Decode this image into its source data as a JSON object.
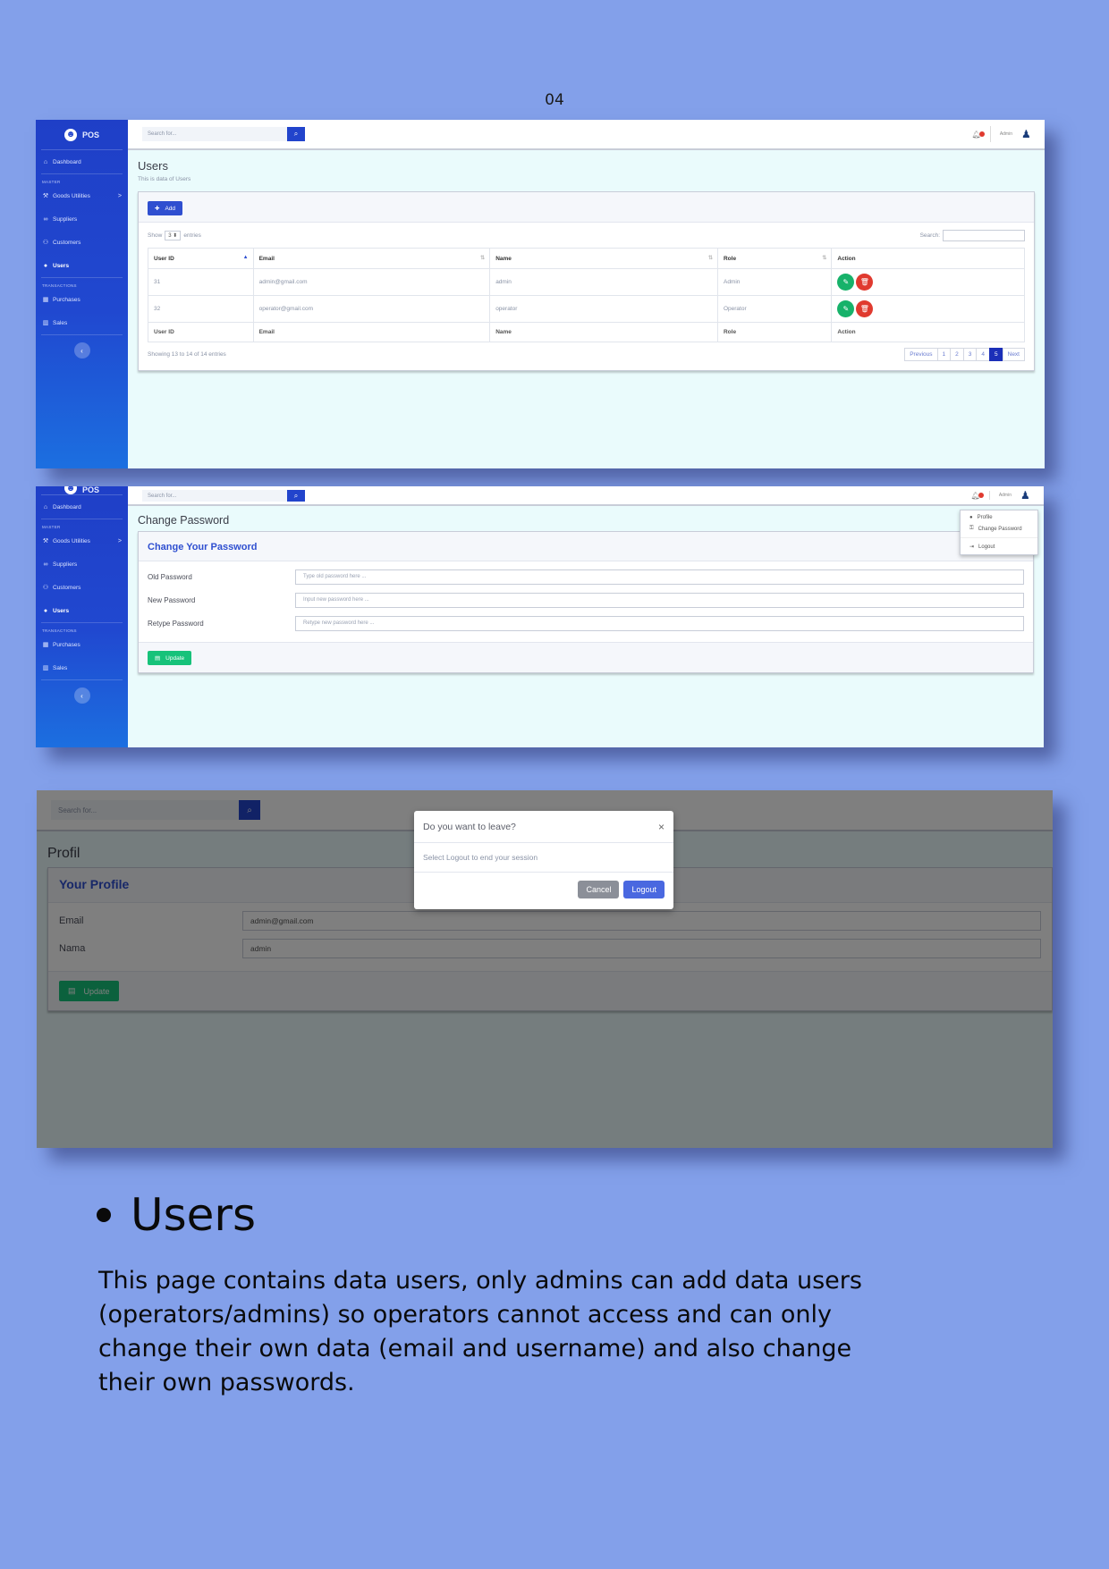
{
  "page": {
    "number": "04"
  },
  "sidebar": {
    "brand": "POS",
    "items": [
      {
        "label": "Dashboard",
        "icon": "dashboard-icon"
      },
      {
        "section": "MASTER"
      },
      {
        "label": "Goods Utilities",
        "icon": "wrench-icon",
        "arrow": ">"
      },
      {
        "label": "Suppliers",
        "icon": "link-icon"
      },
      {
        "label": "Customers",
        "icon": "group-icon"
      },
      {
        "label": "Users",
        "icon": "user-icon",
        "active": true
      },
      {
        "section": "TRANSACTIONS"
      },
      {
        "label": "Purchases",
        "icon": "table-icon"
      },
      {
        "label": "Sales",
        "icon": "chart-icon"
      }
    ]
  },
  "topbar": {
    "search_placeholder": "Search for...",
    "user_name": "Admin"
  },
  "users_page": {
    "title": "Users",
    "subtitle": "This is data of Users",
    "add_label": "Add",
    "show_label": "Show",
    "entries_value": "3",
    "entries_label": "entries",
    "search_label": "Search:",
    "columns": [
      "User ID",
      "Email",
      "Name",
      "Role",
      "Action"
    ],
    "rows": [
      {
        "id": "31",
        "email": "admin@gmail.com",
        "name": "admin",
        "role": "Admin"
      },
      {
        "id": "32",
        "email": "operator@gmail.com",
        "name": "operator",
        "role": "Operator"
      }
    ],
    "info": "Showing 13 to 14 of 14 entries",
    "pager": [
      "Previous",
      "1",
      "2",
      "3",
      "4",
      "5",
      "Next"
    ],
    "current_page": "5"
  },
  "password_page": {
    "title": "Change Password",
    "card_title": "Change Your Password",
    "fields": [
      {
        "label": "Old Password",
        "placeholder": "Type old password here ..."
      },
      {
        "label": "New Password",
        "placeholder": "Input new password here ..."
      },
      {
        "label": "Retype Password",
        "placeholder": "Retype new password here ..."
      }
    ],
    "update_label": "Update",
    "dropdown": [
      "Profile",
      "Change Password",
      "Logout"
    ]
  },
  "profile_page": {
    "title": "Profil",
    "card_title": "Your Profile",
    "fields": [
      {
        "label": "Email",
        "value": "admin@gmail.com"
      },
      {
        "label": "Nama",
        "value": "admin"
      }
    ],
    "update_label": "Update"
  },
  "modal": {
    "title": "Do you want to leave?",
    "close": "×",
    "body": "Select Logout to end your session",
    "cancel_label": "Cancel",
    "logout_label": "Logout"
  },
  "section": {
    "heading": "Users",
    "description": "This page contains data users, only admins can add data users (operators/admins) so operators cannot access and can only change their own data (email and username) and also change their own passwords."
  },
  "colors": {
    "background": "#83a0ea",
    "sidebar": "#2048d0",
    "primary": "#2f4fd0",
    "success": "#17b26a",
    "danger": "#e03a2f"
  }
}
